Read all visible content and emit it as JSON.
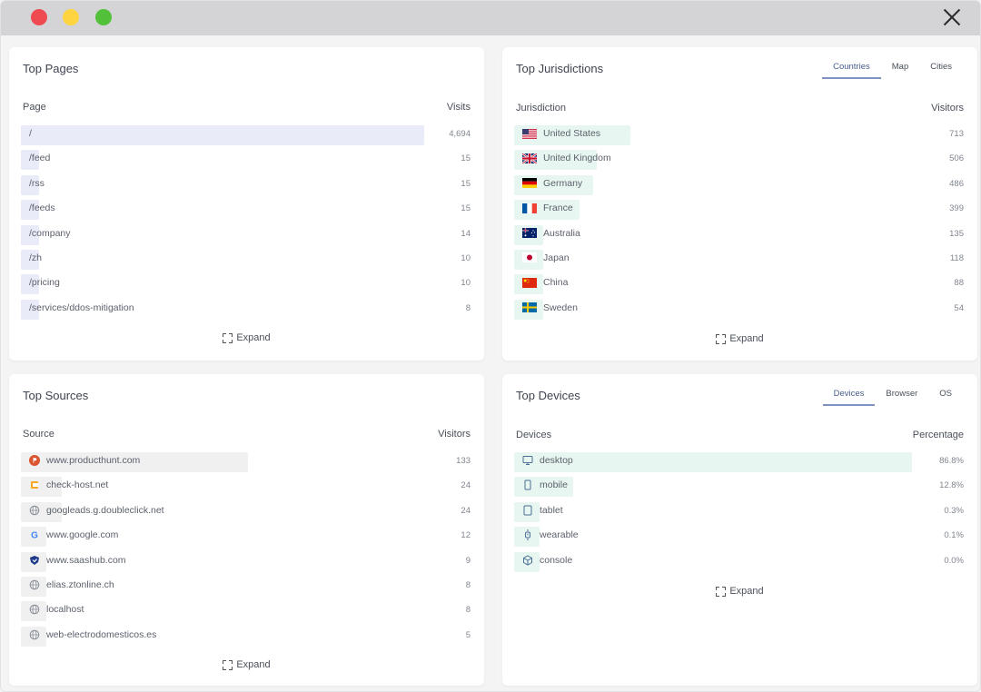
{
  "colors": {
    "pages_bar": "#e9ecf8",
    "jurisdictions_bar": "#e8f6f1",
    "sources_bar": "#f0f0f1",
    "devices_bar": "#e8f6f1"
  },
  "top_pages": {
    "title": "Top Pages",
    "col_left": "Page",
    "col_right": "Visits",
    "expand": "Expand",
    "rows": [
      {
        "label": "/",
        "value": "4,694",
        "share": 1.0
      },
      {
        "label": "/feed",
        "value": "15",
        "share": 0.04
      },
      {
        "label": "/rss",
        "value": "15",
        "share": 0.04
      },
      {
        "label": "/feeds",
        "value": "15",
        "share": 0.04
      },
      {
        "label": "/company",
        "value": "14",
        "share": 0.04
      },
      {
        "label": "/zh",
        "value": "10",
        "share": 0.04
      },
      {
        "label": "/pricing",
        "value": "10",
        "share": 0.04
      },
      {
        "label": "/services/ddos-mitigation",
        "value": "8",
        "share": 0.04
      }
    ]
  },
  "top_jurisdictions": {
    "title": "Top Jurisdictions",
    "tabs": [
      "Countries",
      "Map",
      "Cities"
    ],
    "active_tab": "Countries",
    "col_left": "Jurisdiction",
    "col_right": "Visitors",
    "expand": "Expand",
    "rows": [
      {
        "label": "United States",
        "value": "713",
        "flag": "us-flag-icon",
        "share": 1.0
      },
      {
        "label": "United Kingdom",
        "value": "506",
        "flag": "uk-flag-icon",
        "share": 0.71
      },
      {
        "label": "Germany",
        "value": "486",
        "flag": "de-flag-icon",
        "share": 0.68
      },
      {
        "label": "France",
        "value": "399",
        "flag": "fr-flag-icon",
        "share": 0.56
      },
      {
        "label": "Australia",
        "value": "135",
        "flag": "au-flag-icon",
        "share": 0.25
      },
      {
        "label": "Japan",
        "value": "118",
        "flag": "jp-flag-icon",
        "share": 0.25
      },
      {
        "label": "China",
        "value": "88",
        "flag": "cn-flag-icon",
        "share": 0.25
      },
      {
        "label": "Sweden",
        "value": "54",
        "flag": "se-flag-icon",
        "share": 0.25
      }
    ]
  },
  "top_sources": {
    "title": "Top Sources",
    "col_left": "Source",
    "col_right": "Visitors",
    "expand": "Expand",
    "rows": [
      {
        "label": "www.producthunt.com",
        "value": "133",
        "icon": "producthunt-icon",
        "share": 1.0
      },
      {
        "label": "check-host.net",
        "value": "24",
        "icon": "check-host-icon",
        "share": 0.18
      },
      {
        "label": "googleads.g.doubleclick.net",
        "value": "24",
        "icon": "globe-icon",
        "share": 0.18
      },
      {
        "label": "www.google.com",
        "value": "12",
        "icon": "google-icon",
        "share": 0.1
      },
      {
        "label": "www.saashub.com",
        "value": "9",
        "icon": "saashub-icon",
        "share": 0.08
      },
      {
        "label": "elias.ztonline.ch",
        "value": "8",
        "icon": "globe-icon",
        "share": 0.08
      },
      {
        "label": "localhost",
        "value": "8",
        "icon": "globe-icon",
        "share": 0.08
      },
      {
        "label": "web-electrodomesticos.es",
        "value": "5",
        "icon": "globe-icon",
        "share": 0.08
      }
    ]
  },
  "top_devices": {
    "title": "Top Devices",
    "tabs": [
      "Devices",
      "Browser",
      "OS"
    ],
    "active_tab": "Devices",
    "col_left": "Devices",
    "col_right": "Percentage",
    "expand": "Expand",
    "rows": [
      {
        "label": "desktop",
        "value": "86.8%",
        "icon": "desktop-icon",
        "share": 0.868
      },
      {
        "label": "mobile",
        "value": "12.8%",
        "icon": "mobile-icon",
        "share": 0.128
      },
      {
        "label": "tablet",
        "value": "0.3%",
        "icon": "tablet-icon",
        "share": 0.003
      },
      {
        "label": "wearable",
        "value": "0.1%",
        "icon": "wearable-icon",
        "share": 0.001
      },
      {
        "label": "console",
        "value": "0.0%",
        "icon": "console-icon",
        "share": 0.0
      }
    ]
  }
}
